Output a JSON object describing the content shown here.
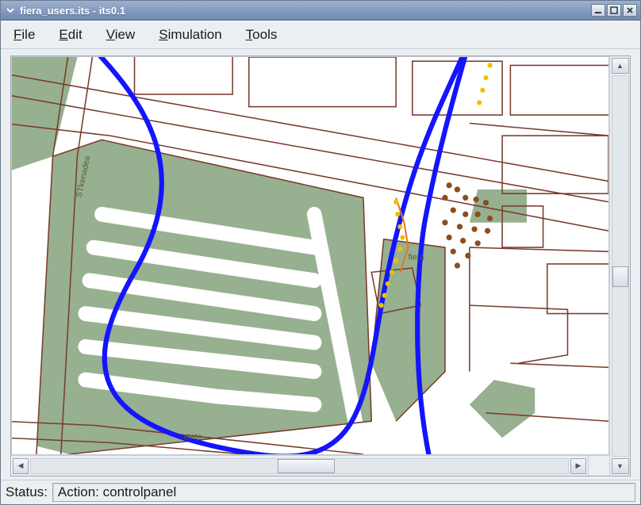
{
  "window": {
    "title": "fiera_users.its - its0.1"
  },
  "menu": {
    "items": [
      {
        "pre": "",
        "mn": "F",
        "post": "ile"
      },
      {
        "pre": "",
        "mn": "E",
        "post": "dit"
      },
      {
        "pre": "",
        "mn": "V",
        "post": "iew"
      },
      {
        "pre": "",
        "mn": "S",
        "post": "imulation"
      },
      {
        "pre": "",
        "mn": "T",
        "post": "ools"
      }
    ]
  },
  "map": {
    "labels": {
      "street1": "STkenadea",
      "street2": "utate",
      "place": "fiera"
    },
    "colors": {
      "green": "#97b08f",
      "blue": "#1414ff",
      "building": "#7a3c2e",
      "yellow": "#f0c000",
      "brown": "#8b4e20",
      "orange": "#e07820"
    }
  },
  "status": {
    "label": "Status:",
    "value": "Action: controlpanel"
  }
}
